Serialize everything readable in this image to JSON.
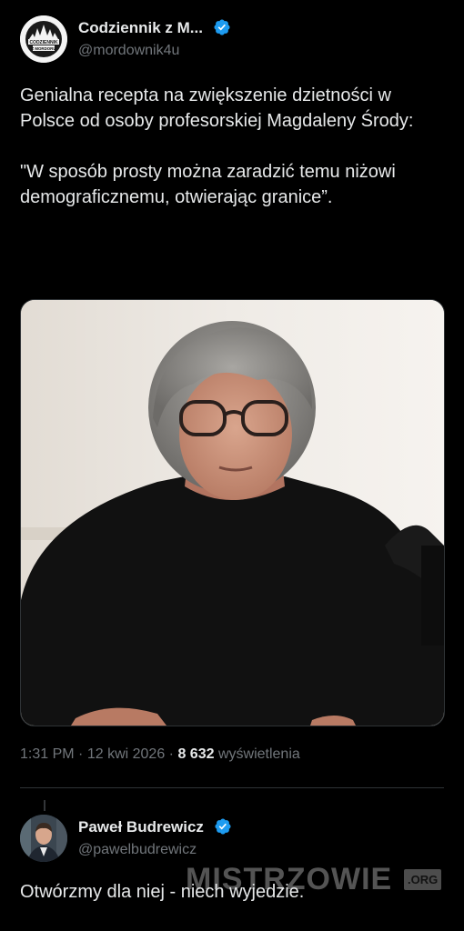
{
  "tweet": {
    "author_name": "Codziennik z M...",
    "author_handle": "@mordownik4u",
    "avatar_text_line1": "CODZIENNIK",
    "avatar_text_line2": "Z MORDORU",
    "paragraph1": "Genialna recepta na zwiększenie dzietności w Polsce od osoby profesorskiej Magdaleny Środy:",
    "paragraph2": "\"W sposób prosty można zaradzić temu niżowi demograficznemu, otwierając granice”.",
    "time": "1:31 PM",
    "date": "12 kwi 2026",
    "views_count": "8 632",
    "views_label": "wyświetlenia",
    "separator": "·"
  },
  "reply": {
    "author_name": "Paweł Budrewicz",
    "author_handle": "@pawelbudrewicz",
    "text": "Otwórzmy dla niej - niech wyjedzie."
  },
  "watermark": {
    "main": "MISTRZOWIE",
    "suffix": ".ORG"
  },
  "colors": {
    "background": "#000000",
    "text": "#e7e9ea",
    "secondary": "#71767b",
    "verified": "#1d9bf0",
    "divider": "#2f3336"
  }
}
